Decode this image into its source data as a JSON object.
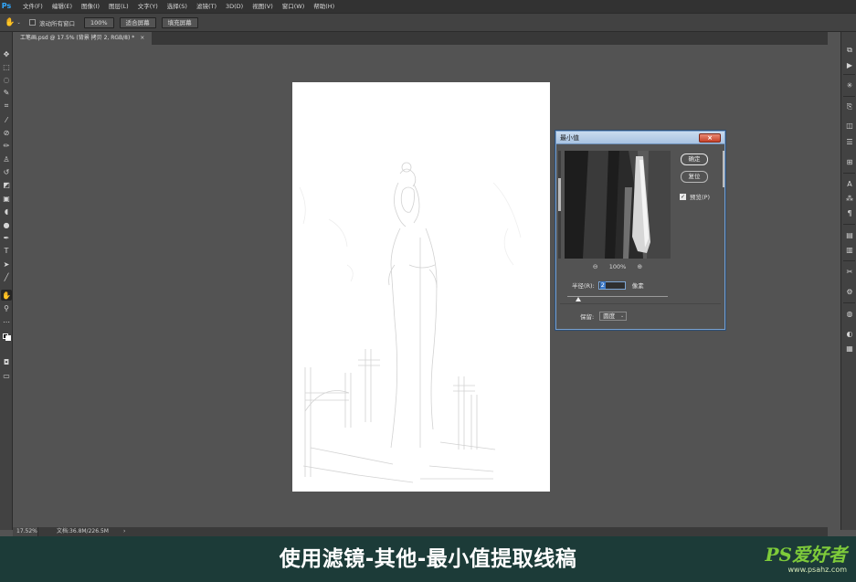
{
  "menubar": {
    "logo": "Ps",
    "items": [
      "文件(F)",
      "编辑(E)",
      "图像(I)",
      "图层(L)",
      "文字(Y)",
      "选择(S)",
      "滤镜(T)",
      "3D(D)",
      "视图(V)",
      "窗口(W)",
      "帮助(H)"
    ]
  },
  "options": {
    "tool_icon": "hand-icon",
    "scroll_all_windows": "滚动所有窗口",
    "zoom_100": "100%",
    "fit_screen": "适合屏幕",
    "fill_screen": "填充屏幕"
  },
  "document": {
    "tab_title": "工笔画.psd @ 17.5% (背景 拷贝 2, RGB/8) *",
    "close": "×"
  },
  "status": {
    "zoom": "17.52%",
    "doc_info": "文档:36.8M/226.5M",
    "arrow": "›"
  },
  "dialog": {
    "title": "最小值",
    "close": "×",
    "ok": "确定",
    "reset": "复位",
    "preview_label": "预览(P)",
    "preview_checked": "✓",
    "zoom_out": "⊖",
    "zoom_level": "100%",
    "zoom_in": "⊕",
    "radius_label": "半径(R):",
    "radius_value": "2",
    "unit": "像素",
    "keep_label": "保留:",
    "keep_value": "圆度",
    "keep_arrow": "⌄"
  },
  "caption": {
    "text": "使用滤镜-其他-最小值提取线稿",
    "watermark_logo": "PS爱好者",
    "watermark_url": "www.psahz.com"
  },
  "colors": {
    "caption_bg": "#1c3b38",
    "workspace": "#535353",
    "watermark_green": "#7ecb3a"
  }
}
